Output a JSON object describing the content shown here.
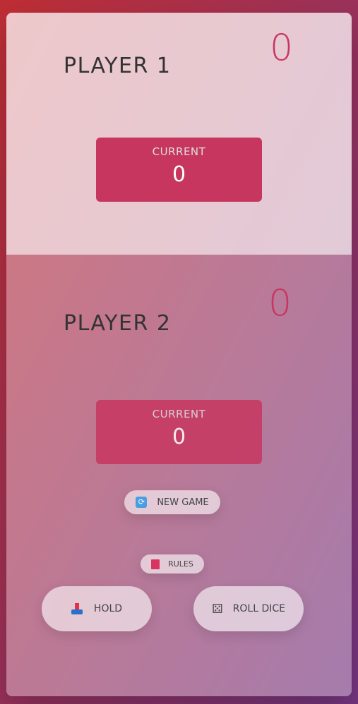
{
  "players": [
    {
      "name": "PLAYER 1",
      "score": "0",
      "current_label": "CURRENT",
      "current_score": "0"
    },
    {
      "name": "PLAYER 2",
      "score": "0",
      "current_label": "CURRENT",
      "current_score": "0"
    }
  ],
  "buttons": {
    "new_game": {
      "label": "NEW GAME",
      "icon": "refresh-icon"
    },
    "rules": {
      "label": "RULES",
      "icon": "book-icon"
    },
    "hold": {
      "label": "HOLD",
      "icon": "inbox-tray-icon"
    },
    "roll": {
      "label": "ROLL DICE",
      "icon": "dice-icon"
    }
  },
  "colors": {
    "accent": "#c7365f",
    "background_gradient": [
      "#bf2e34",
      "#753682"
    ]
  }
}
